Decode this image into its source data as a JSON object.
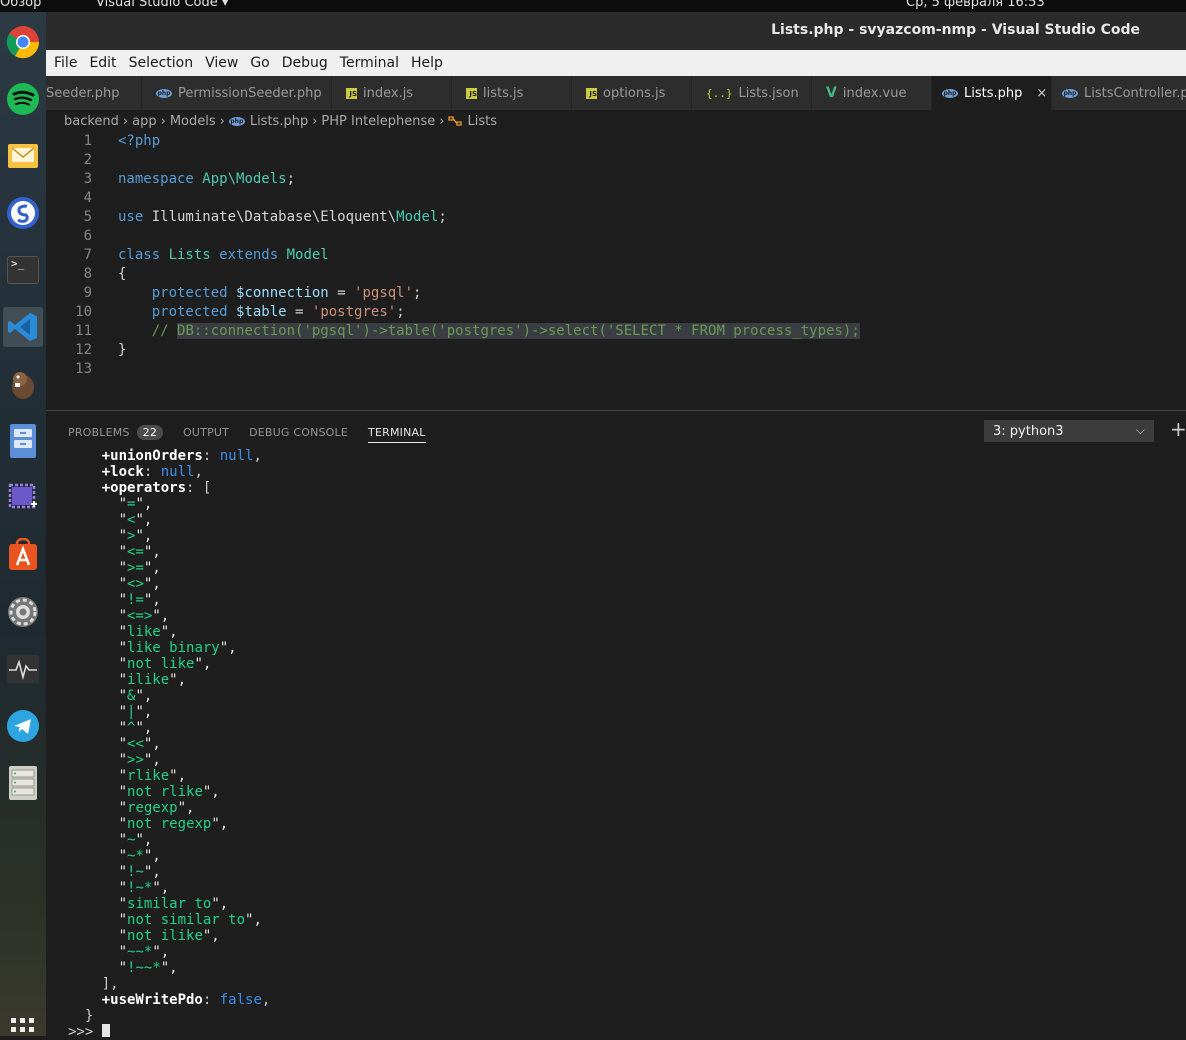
{
  "topbar": {
    "left_label": "Обзор",
    "app_label": "Visual Studio Code ▾",
    "clock": "Ср, 5 февраля  16:53"
  },
  "dock": {
    "items": [
      {
        "name": "chrome"
      },
      {
        "name": "spotify"
      },
      {
        "name": "mail"
      },
      {
        "name": "simplenote"
      },
      {
        "name": "terminal",
        "glyph": ">_"
      },
      {
        "name": "vscode"
      },
      {
        "name": "dbeaver"
      },
      {
        "name": "file-manager"
      },
      {
        "name": "screenshot"
      },
      {
        "name": "software-center"
      },
      {
        "name": "settings"
      },
      {
        "name": "system-monitor"
      },
      {
        "name": "telegram"
      },
      {
        "name": "storage"
      },
      {
        "name": "show-apps"
      }
    ]
  },
  "window": {
    "title": "Lists.php - svyazcom-nmp - Visual Studio Code"
  },
  "menu": [
    "File",
    "Edit",
    "Selection",
    "View",
    "Go",
    "Debug",
    "Terminal",
    "Help"
  ],
  "tabs": [
    {
      "label": "Seeder.php",
      "icon": "php-icon",
      "active": false
    },
    {
      "label": "PermissionSeeder.php",
      "icon": "php-icon",
      "active": false
    },
    {
      "label": "index.js",
      "icon": "js-icon",
      "active": false
    },
    {
      "label": "lists.js",
      "icon": "js-icon",
      "active": false
    },
    {
      "label": "options.js",
      "icon": "js-icon",
      "active": false
    },
    {
      "label": "Lists.json",
      "icon": "json-icon",
      "active": false
    },
    {
      "label": "index.vue",
      "icon": "vue-icon",
      "active": false
    },
    {
      "label": "Lists.php",
      "icon": "php-icon",
      "active": true
    },
    {
      "label": "ListsController.php",
      "icon": "php-icon",
      "active": false
    }
  ],
  "icon_text": {
    "js": "JS",
    "php": "php",
    "json": "{..}",
    "vue": "V",
    "close": "×"
  },
  "breadcrumb": [
    "backend",
    "app",
    "Models",
    "Lists.php",
    "PHP Intelephense",
    "Lists"
  ],
  "editor": {
    "lines": [
      {
        "n": "1",
        "tokens": [
          {
            "t": "<?php",
            "c": "tag"
          }
        ]
      },
      {
        "n": "2",
        "tokens": []
      },
      {
        "n": "3",
        "tokens": [
          {
            "t": "namespace ",
            "c": "kw"
          },
          {
            "t": "App\\Models",
            "c": "ns"
          },
          {
            "t": ";",
            "c": ""
          }
        ]
      },
      {
        "n": "4",
        "tokens": []
      },
      {
        "n": "5",
        "tokens": [
          {
            "t": "use ",
            "c": "kw"
          },
          {
            "t": "Illuminate\\Database\\Eloquent\\",
            "c": ""
          },
          {
            "t": "Model",
            "c": "ns"
          },
          {
            "t": ";",
            "c": ""
          }
        ]
      },
      {
        "n": "6",
        "tokens": []
      },
      {
        "n": "7",
        "tokens": [
          {
            "t": "class ",
            "c": "kw"
          },
          {
            "t": "Lists ",
            "c": "ns"
          },
          {
            "t": "extends ",
            "c": "kw"
          },
          {
            "t": "Model",
            "c": "ns"
          }
        ]
      },
      {
        "n": "8",
        "tokens": [
          {
            "t": "{",
            "c": ""
          }
        ]
      },
      {
        "n": "9",
        "tokens": [
          {
            "t": "    protected ",
            "c": "kw"
          },
          {
            "t": "$connection",
            "c": "var"
          },
          {
            "t": " = ",
            "c": ""
          },
          {
            "t": "'pgsql'",
            "c": "str"
          },
          {
            "t": ";",
            "c": ""
          }
        ]
      },
      {
        "n": "10",
        "tokens": [
          {
            "t": "    protected ",
            "c": "kw"
          },
          {
            "t": "$table",
            "c": "var"
          },
          {
            "t": " = ",
            "c": ""
          },
          {
            "t": "'postgres'",
            "c": "str"
          },
          {
            "t": ";",
            "c": ""
          }
        ]
      },
      {
        "n": "11",
        "tokens": [
          {
            "t": "    // ",
            "c": "com"
          },
          {
            "t": "DB::connection('pgsql')->table('postgres')->select('SELECT * FROM process_types);",
            "c": "com sel"
          }
        ]
      },
      {
        "n": "12",
        "tokens": [
          {
            "t": "}",
            "c": ""
          }
        ]
      },
      {
        "n": "13",
        "tokens": []
      }
    ]
  },
  "panel": {
    "tabs": [
      {
        "label": "PROBLEMS",
        "badge": "22",
        "active": false
      },
      {
        "label": "OUTPUT",
        "active": false
      },
      {
        "label": "DEBUG CONSOLE",
        "active": false
      },
      {
        "label": "TERMINAL",
        "active": true
      }
    ],
    "terminal_select": "3: python3",
    "chevron": "⌵",
    "plus": "+"
  },
  "terminal": {
    "lines": [
      {
        "indent": "    ",
        "tokens": [
          {
            "t": "+unionOrders",
            "c": "key"
          },
          {
            "t": ": ",
            "c": "punc"
          },
          {
            "t": "null",
            "c": "null"
          },
          {
            "t": ",",
            "c": "punc"
          }
        ]
      },
      {
        "indent": "    ",
        "tokens": [
          {
            "t": "+lock",
            "c": "key"
          },
          {
            "t": ": ",
            "c": "punc"
          },
          {
            "t": "null",
            "c": "null"
          },
          {
            "t": ",",
            "c": "punc"
          }
        ]
      },
      {
        "indent": "    ",
        "tokens": [
          {
            "t": "+operators",
            "c": "key"
          },
          {
            "t": ": [",
            "c": "punc"
          }
        ]
      },
      {
        "indent": "      ",
        "tokens": [
          {
            "t": "\"",
            "c": "q"
          },
          {
            "t": "=",
            "c": "str"
          },
          {
            "t": "\",",
            "c": "q"
          }
        ]
      },
      {
        "indent": "      ",
        "tokens": [
          {
            "t": "\"",
            "c": "q"
          },
          {
            "t": "<",
            "c": "str"
          },
          {
            "t": "\",",
            "c": "q"
          }
        ]
      },
      {
        "indent": "      ",
        "tokens": [
          {
            "t": "\"",
            "c": "q"
          },
          {
            "t": ">",
            "c": "str"
          },
          {
            "t": "\",",
            "c": "q"
          }
        ]
      },
      {
        "indent": "      ",
        "tokens": [
          {
            "t": "\"",
            "c": "q"
          },
          {
            "t": "<=",
            "c": "str"
          },
          {
            "t": "\",",
            "c": "q"
          }
        ]
      },
      {
        "indent": "      ",
        "tokens": [
          {
            "t": "\"",
            "c": "q"
          },
          {
            "t": ">=",
            "c": "str"
          },
          {
            "t": "\",",
            "c": "q"
          }
        ]
      },
      {
        "indent": "      ",
        "tokens": [
          {
            "t": "\"",
            "c": "q"
          },
          {
            "t": "<>",
            "c": "str"
          },
          {
            "t": "\",",
            "c": "q"
          }
        ]
      },
      {
        "indent": "      ",
        "tokens": [
          {
            "t": "\"",
            "c": "q"
          },
          {
            "t": "!=",
            "c": "str"
          },
          {
            "t": "\",",
            "c": "q"
          }
        ]
      },
      {
        "indent": "      ",
        "tokens": [
          {
            "t": "\"",
            "c": "q"
          },
          {
            "t": "<=>",
            "c": "str"
          },
          {
            "t": "\",",
            "c": "q"
          }
        ]
      },
      {
        "indent": "      ",
        "tokens": [
          {
            "t": "\"",
            "c": "q"
          },
          {
            "t": "like",
            "c": "str"
          },
          {
            "t": "\",",
            "c": "q"
          }
        ]
      },
      {
        "indent": "      ",
        "tokens": [
          {
            "t": "\"",
            "c": "q"
          },
          {
            "t": "like binary",
            "c": "str"
          },
          {
            "t": "\",",
            "c": "q"
          }
        ]
      },
      {
        "indent": "      ",
        "tokens": [
          {
            "t": "\"",
            "c": "q"
          },
          {
            "t": "not like",
            "c": "str"
          },
          {
            "t": "\",",
            "c": "q"
          }
        ]
      },
      {
        "indent": "      ",
        "tokens": [
          {
            "t": "\"",
            "c": "q"
          },
          {
            "t": "ilike",
            "c": "str"
          },
          {
            "t": "\",",
            "c": "q"
          }
        ]
      },
      {
        "indent": "      ",
        "tokens": [
          {
            "t": "\"",
            "c": "q"
          },
          {
            "t": "&",
            "c": "str"
          },
          {
            "t": "\",",
            "c": "q"
          }
        ]
      },
      {
        "indent": "      ",
        "tokens": [
          {
            "t": "\"",
            "c": "q"
          },
          {
            "t": "|",
            "c": "str"
          },
          {
            "t": "\",",
            "c": "q"
          }
        ]
      },
      {
        "indent": "      ",
        "tokens": [
          {
            "t": "\"",
            "c": "q"
          },
          {
            "t": "^",
            "c": "str"
          },
          {
            "t": "\",",
            "c": "q"
          }
        ]
      },
      {
        "indent": "      ",
        "tokens": [
          {
            "t": "\"",
            "c": "q"
          },
          {
            "t": "<<",
            "c": "str"
          },
          {
            "t": "\",",
            "c": "q"
          }
        ]
      },
      {
        "indent": "      ",
        "tokens": [
          {
            "t": "\"",
            "c": "q"
          },
          {
            "t": ">>",
            "c": "str"
          },
          {
            "t": "\",",
            "c": "q"
          }
        ]
      },
      {
        "indent": "      ",
        "tokens": [
          {
            "t": "\"",
            "c": "q"
          },
          {
            "t": "rlike",
            "c": "str"
          },
          {
            "t": "\",",
            "c": "q"
          }
        ]
      },
      {
        "indent": "      ",
        "tokens": [
          {
            "t": "\"",
            "c": "q"
          },
          {
            "t": "not rlike",
            "c": "str"
          },
          {
            "t": "\",",
            "c": "q"
          }
        ]
      },
      {
        "indent": "      ",
        "tokens": [
          {
            "t": "\"",
            "c": "q"
          },
          {
            "t": "regexp",
            "c": "str"
          },
          {
            "t": "\",",
            "c": "q"
          }
        ]
      },
      {
        "indent": "      ",
        "tokens": [
          {
            "t": "\"",
            "c": "q"
          },
          {
            "t": "not regexp",
            "c": "str"
          },
          {
            "t": "\",",
            "c": "q"
          }
        ]
      },
      {
        "indent": "      ",
        "tokens": [
          {
            "t": "\"",
            "c": "q"
          },
          {
            "t": "~",
            "c": "str"
          },
          {
            "t": "\",",
            "c": "q"
          }
        ]
      },
      {
        "indent": "      ",
        "tokens": [
          {
            "t": "\"",
            "c": "q"
          },
          {
            "t": "~*",
            "c": "str"
          },
          {
            "t": "\",",
            "c": "q"
          }
        ]
      },
      {
        "indent": "      ",
        "tokens": [
          {
            "t": "\"",
            "c": "q"
          },
          {
            "t": "!~",
            "c": "str"
          },
          {
            "t": "\",",
            "c": "q"
          }
        ]
      },
      {
        "indent": "      ",
        "tokens": [
          {
            "t": "\"",
            "c": "q"
          },
          {
            "t": "!~*",
            "c": "str"
          },
          {
            "t": "\",",
            "c": "q"
          }
        ]
      },
      {
        "indent": "      ",
        "tokens": [
          {
            "t": "\"",
            "c": "q"
          },
          {
            "t": "similar to",
            "c": "str"
          },
          {
            "t": "\",",
            "c": "q"
          }
        ]
      },
      {
        "indent": "      ",
        "tokens": [
          {
            "t": "\"",
            "c": "q"
          },
          {
            "t": "not similar to",
            "c": "str"
          },
          {
            "t": "\",",
            "c": "q"
          }
        ]
      },
      {
        "indent": "      ",
        "tokens": [
          {
            "t": "\"",
            "c": "q"
          },
          {
            "t": "not ilike",
            "c": "str"
          },
          {
            "t": "\",",
            "c": "q"
          }
        ]
      },
      {
        "indent": "      ",
        "tokens": [
          {
            "t": "\"",
            "c": "q"
          },
          {
            "t": "~~*",
            "c": "str"
          },
          {
            "t": "\",",
            "c": "q"
          }
        ]
      },
      {
        "indent": "      ",
        "tokens": [
          {
            "t": "\"",
            "c": "q"
          },
          {
            "t": "!~~*",
            "c": "str"
          },
          {
            "t": "\",",
            "c": "q"
          }
        ]
      },
      {
        "indent": "    ",
        "tokens": [
          {
            "t": "],",
            "c": "punc"
          }
        ]
      },
      {
        "indent": "    ",
        "tokens": [
          {
            "t": "+useWritePdo",
            "c": "key"
          },
          {
            "t": ": ",
            "c": "punc"
          },
          {
            "t": "false",
            "c": "null"
          },
          {
            "t": ",",
            "c": "punc"
          }
        ]
      },
      {
        "indent": "  ",
        "tokens": [
          {
            "t": "}",
            "c": "punc"
          }
        ]
      },
      {
        "indent": "",
        "tokens": [
          {
            "t": ">>> ",
            "c": "punc"
          }
        ],
        "cursor": true
      }
    ]
  },
  "colors": {
    "editor_bg": "#1e1e1e",
    "terminal_string": "#23d18b",
    "terminal_null": "#3b8eea",
    "accent_blue": "#569cd6"
  }
}
